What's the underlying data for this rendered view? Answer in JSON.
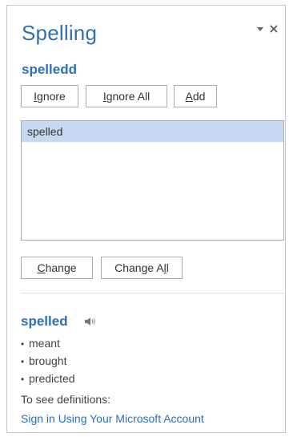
{
  "pane": {
    "title": "Spelling",
    "misspelled_word": "spelledd"
  },
  "buttons": {
    "ignore": {
      "pre": "",
      "key": "I",
      "post": "gnore"
    },
    "ignore_all": {
      "pre": "",
      "key": "I",
      "post": "gnore All"
    },
    "add": {
      "pre": "",
      "key": "A",
      "post": "dd"
    },
    "change": {
      "pre": "",
      "key": "C",
      "post": "hange"
    },
    "change_all": {
      "pre": "Change A",
      "key": "l",
      "post": "l"
    }
  },
  "suggestions": [
    {
      "text": "spelled",
      "selected": true
    }
  ],
  "definition": {
    "word": "spelled",
    "synonyms": [
      "meant",
      "brought",
      "predicted"
    ],
    "note": "To see definitions:",
    "link": "Sign in Using Your Microsoft Account"
  },
  "icons": {
    "menu": "dropdown-arrow-icon",
    "close": "close-icon",
    "speaker": "speaker-icon"
  },
  "colors": {
    "accent": "#2e6fb5",
    "selection": "#c5d9f1",
    "border": "#acacac"
  }
}
